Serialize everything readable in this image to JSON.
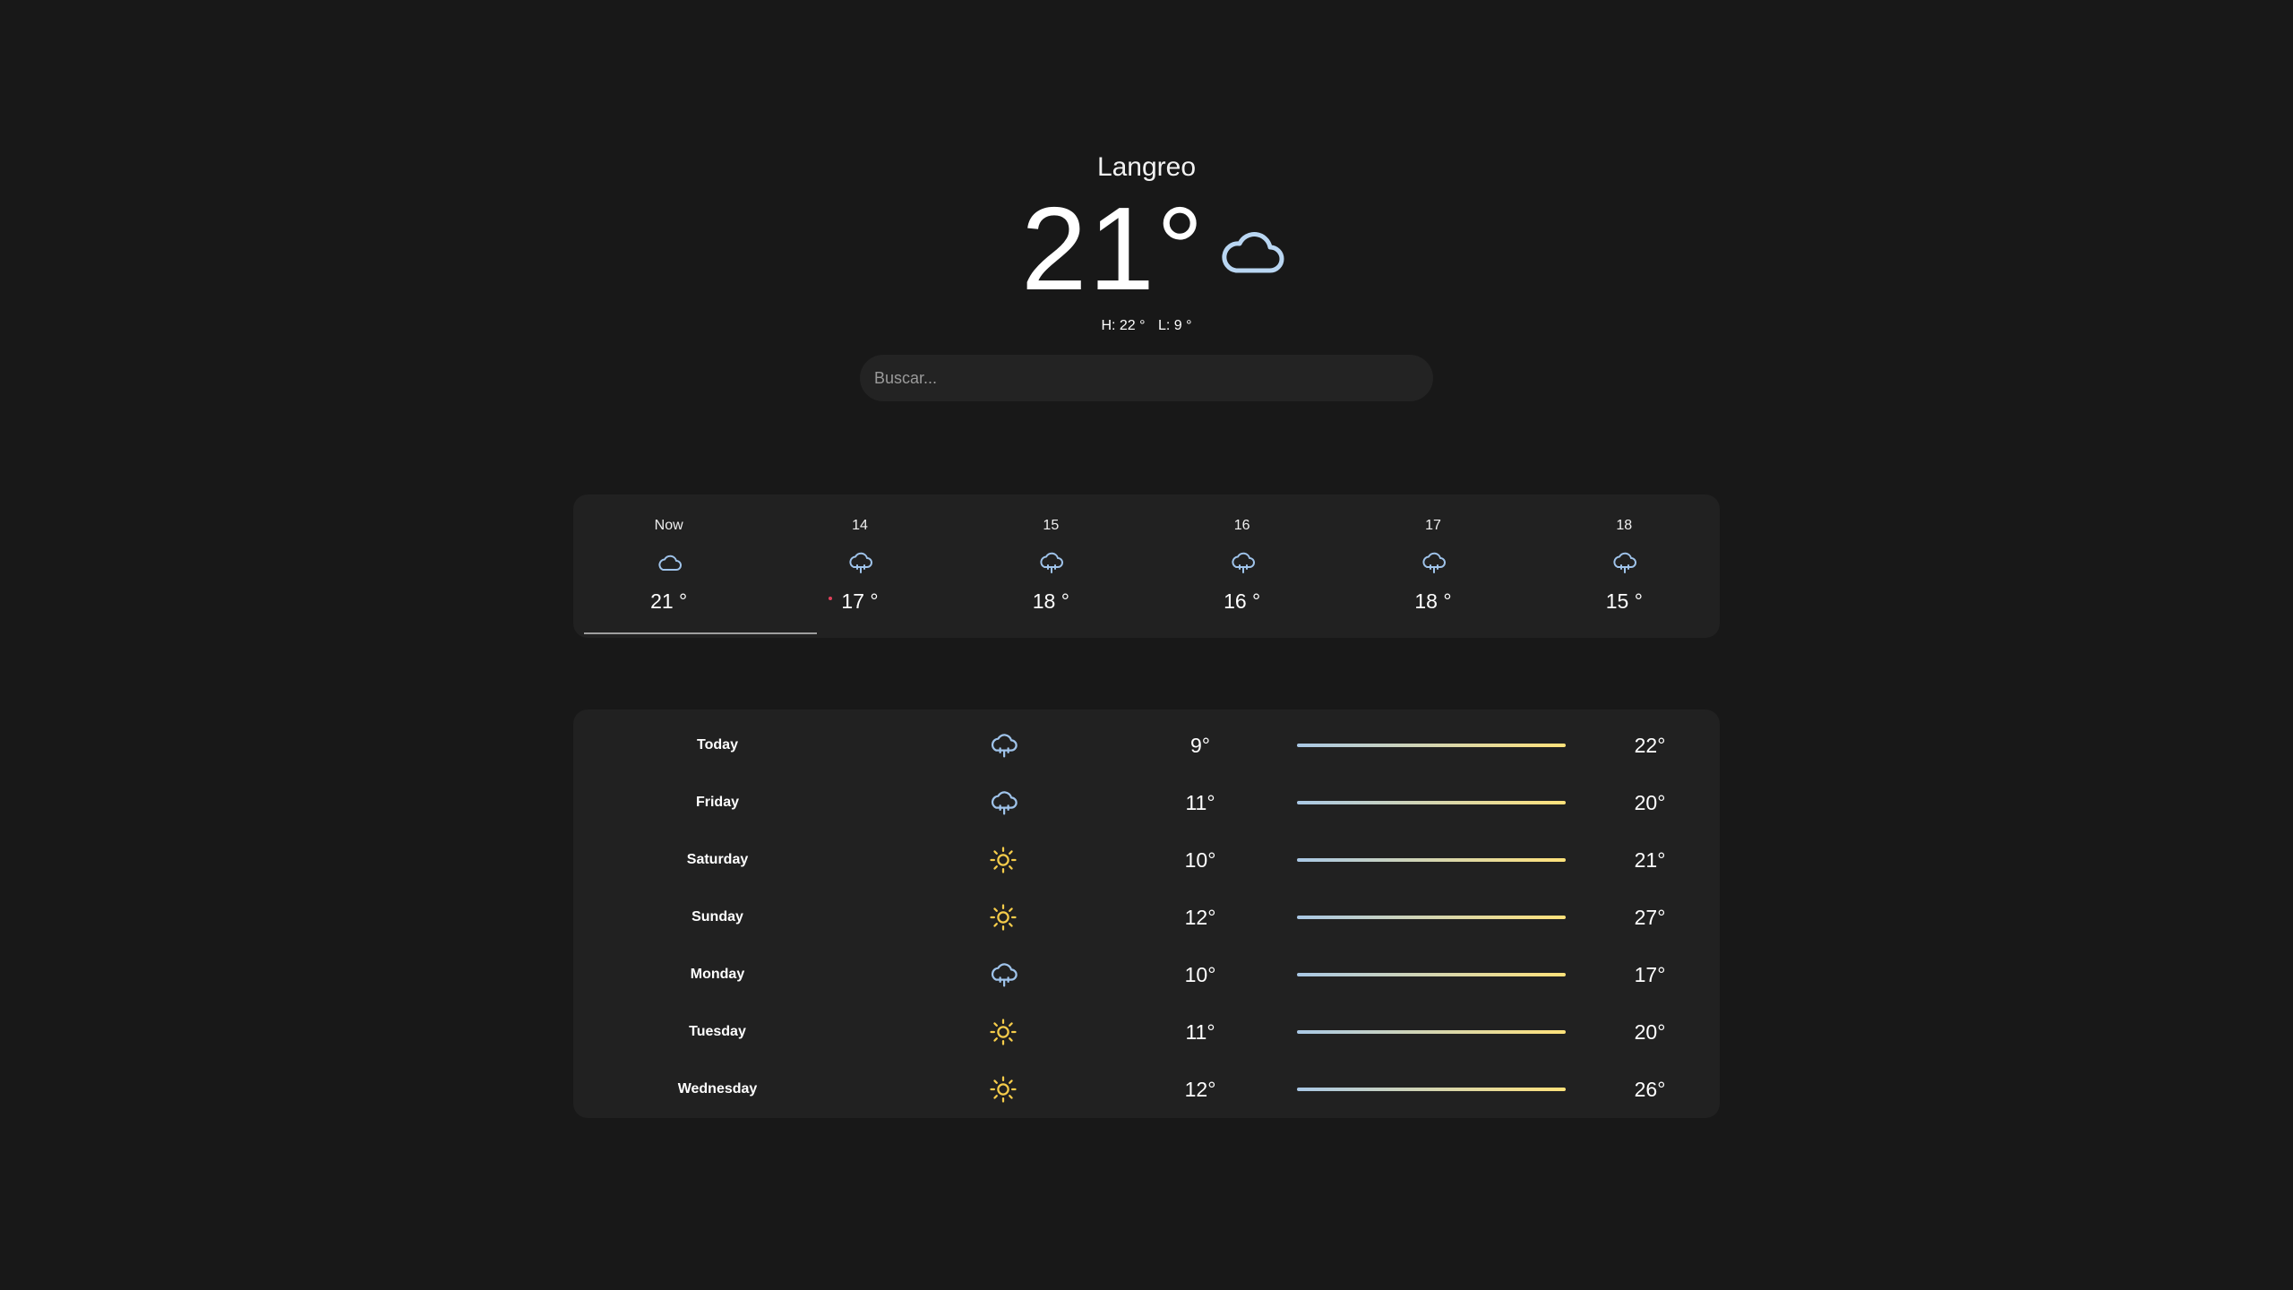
{
  "current": {
    "city": "Langreo",
    "temp": "21°",
    "icon": "cloud-icon",
    "high": "H: 22 °",
    "low": "L: 9 °"
  },
  "search": {
    "placeholder": "Buscar..."
  },
  "hourly": [
    {
      "label": "Now",
      "icon": "cloud-icon",
      "temp": "21 °"
    },
    {
      "label": "14",
      "icon": "cloud-rain-icon",
      "temp": "17 °"
    },
    {
      "label": "15",
      "icon": "cloud-rain-icon",
      "temp": "18 °"
    },
    {
      "label": "16",
      "icon": "cloud-rain-icon",
      "temp": "16 °"
    },
    {
      "label": "17",
      "icon": "cloud-rain-icon",
      "temp": "18 °"
    },
    {
      "label": "18",
      "icon": "cloud-rain-icon",
      "temp": "15 °"
    }
  ],
  "daily": [
    {
      "day": "Today",
      "icon": "cloud-rain-icon",
      "low": "9°",
      "high": "22°"
    },
    {
      "day": "Friday",
      "icon": "cloud-rain-icon",
      "low": "11°",
      "high": "20°"
    },
    {
      "day": "Saturday",
      "icon": "sun-icon",
      "low": "10°",
      "high": "21°"
    },
    {
      "day": "Sunday",
      "icon": "sun-icon",
      "low": "12°",
      "high": "27°"
    },
    {
      "day": "Monday",
      "icon": "cloud-rain-icon",
      "low": "10°",
      "high": "17°"
    },
    {
      "day": "Tuesday",
      "icon": "sun-icon",
      "low": "11°",
      "high": "20°"
    },
    {
      "day": "Wednesday",
      "icon": "sun-icon",
      "low": "12°",
      "high": "26°"
    }
  ],
  "colors": {
    "background": "#181818",
    "card": "#212121",
    "rain_icon": "#9fc3ea",
    "sun_icon": "#f5cc4a",
    "bar_start": "#a9c8e6",
    "bar_end": "#ffe27a"
  }
}
